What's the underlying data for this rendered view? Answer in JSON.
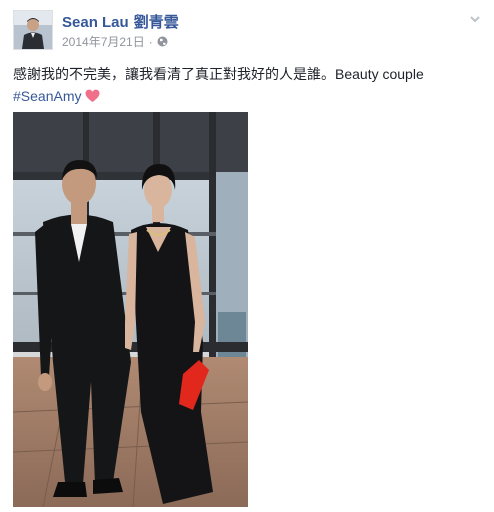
{
  "post": {
    "author_name": "Sean Lau",
    "author_name_cjk": "劉青雲",
    "date": "2014年7月21日",
    "separator": "·",
    "privacy_icon": "globe-icon",
    "menu_icon": "chevron-down-icon",
    "text_line1": "感謝我的不完美，讓我看清了真正對我好的人是誰。Beauty couple",
    "hashtag": "#SeanAmy",
    "heart_icon": "heart-icon",
    "colors": {
      "link": "#365899",
      "meta": "#90949c",
      "text": "#1d2129",
      "heart": "#f0708a"
    }
  }
}
